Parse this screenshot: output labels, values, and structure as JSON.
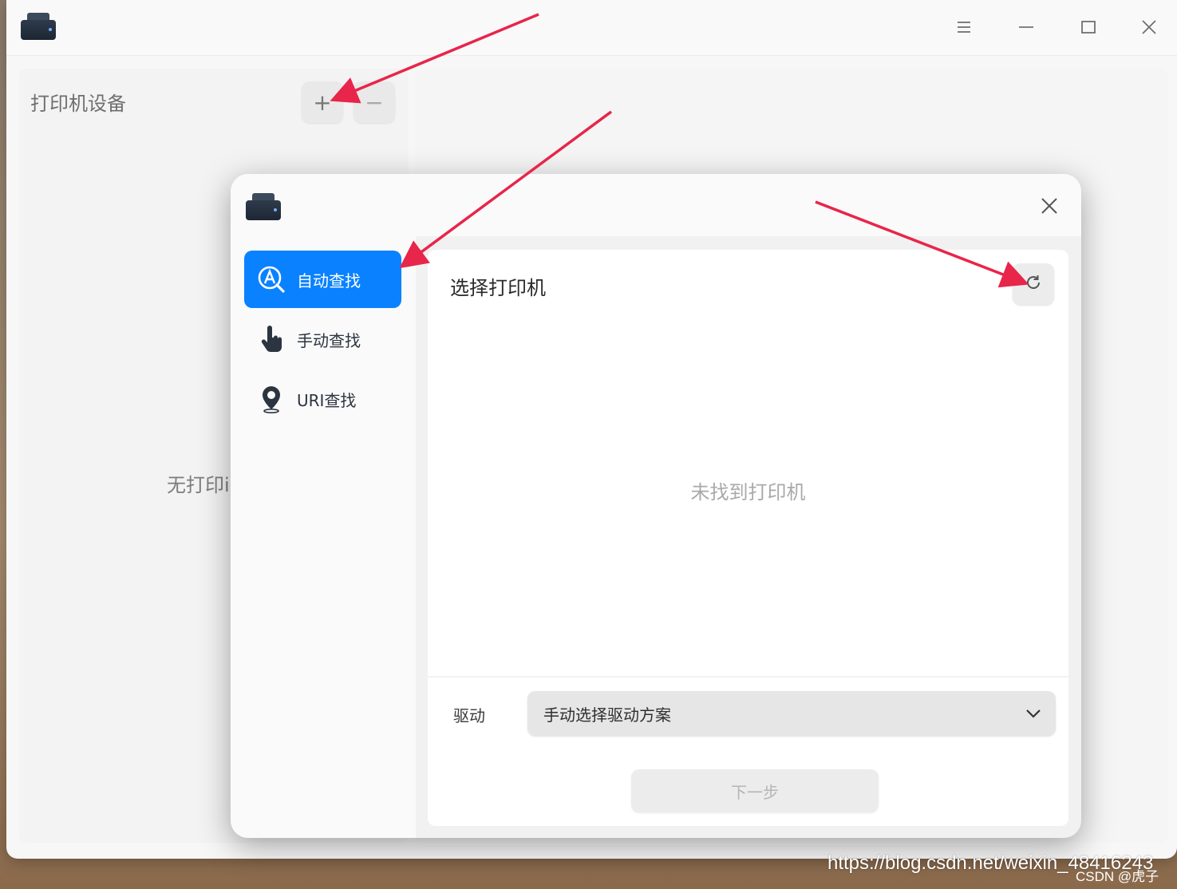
{
  "main_window": {
    "left_panel_title": "打印机设备",
    "add_label": "+",
    "remove_label": "−",
    "no_printer_text": "无打印i"
  },
  "dialog": {
    "nav": [
      {
        "label": "自动查找",
        "icon": "auto-search-icon",
        "active": true
      },
      {
        "label": "手动查找",
        "icon": "hand-pointer-icon",
        "active": false
      },
      {
        "label": "URI查找",
        "icon": "location-pin-icon",
        "active": false
      }
    ],
    "content_title": "选择打印机",
    "empty_message": "未找到打印机",
    "driver_label": "驱动",
    "driver_value": "手动选择驱动方案",
    "next_label": "下一步"
  },
  "watermark": {
    "url": "https://blog.csdn.net/weixin_48416243",
    "author": "CSDN @虎子"
  },
  "colors": {
    "accent": "#0a82ff",
    "annotation_arrow": "#e8254a"
  }
}
